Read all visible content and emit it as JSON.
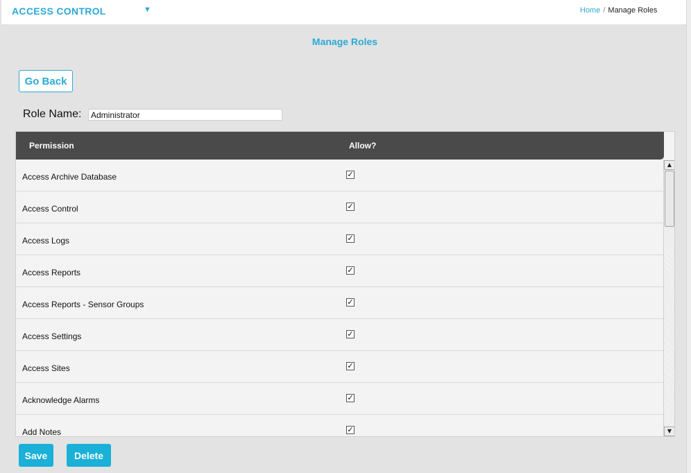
{
  "header": {
    "app_title": "ACCESS CONTROL",
    "breadcrumb": {
      "home": "Home",
      "separator": "/",
      "current": "Manage Roles"
    }
  },
  "page": {
    "title": "Manage Roles",
    "go_back_label": "Go Back",
    "role_name_label": "Role Name:",
    "role_name_value": "Administrator"
  },
  "table": {
    "columns": [
      "Permission",
      "Allow?"
    ],
    "rows": [
      {
        "permission": "Access Archive Database",
        "allowed": true
      },
      {
        "permission": "Access Control",
        "allowed": true
      },
      {
        "permission": "Access Logs",
        "allowed": true
      },
      {
        "permission": "Access Reports",
        "allowed": true
      },
      {
        "permission": "Access Reports - Sensor Groups",
        "allowed": true
      },
      {
        "permission": "Access Settings",
        "allowed": true
      },
      {
        "permission": "Access Sites",
        "allowed": true
      },
      {
        "permission": "Acknowledge Alarms",
        "allowed": true
      },
      {
        "permission": "Add Notes",
        "allowed": true
      }
    ]
  },
  "actions": {
    "save_label": "Save",
    "delete_label": "Delete"
  },
  "icons": {
    "app_menu": "chevron-down-icon",
    "checkbox": "checkmark-icon",
    "scroll_up": "arrow-up-icon",
    "scroll_down": "arrow-down-icon"
  },
  "colors": {
    "accent": "#2aa9d6",
    "button_fill": "#1ab0d8",
    "table_header": "#4a4a4a",
    "background": "#e3e3e3"
  }
}
